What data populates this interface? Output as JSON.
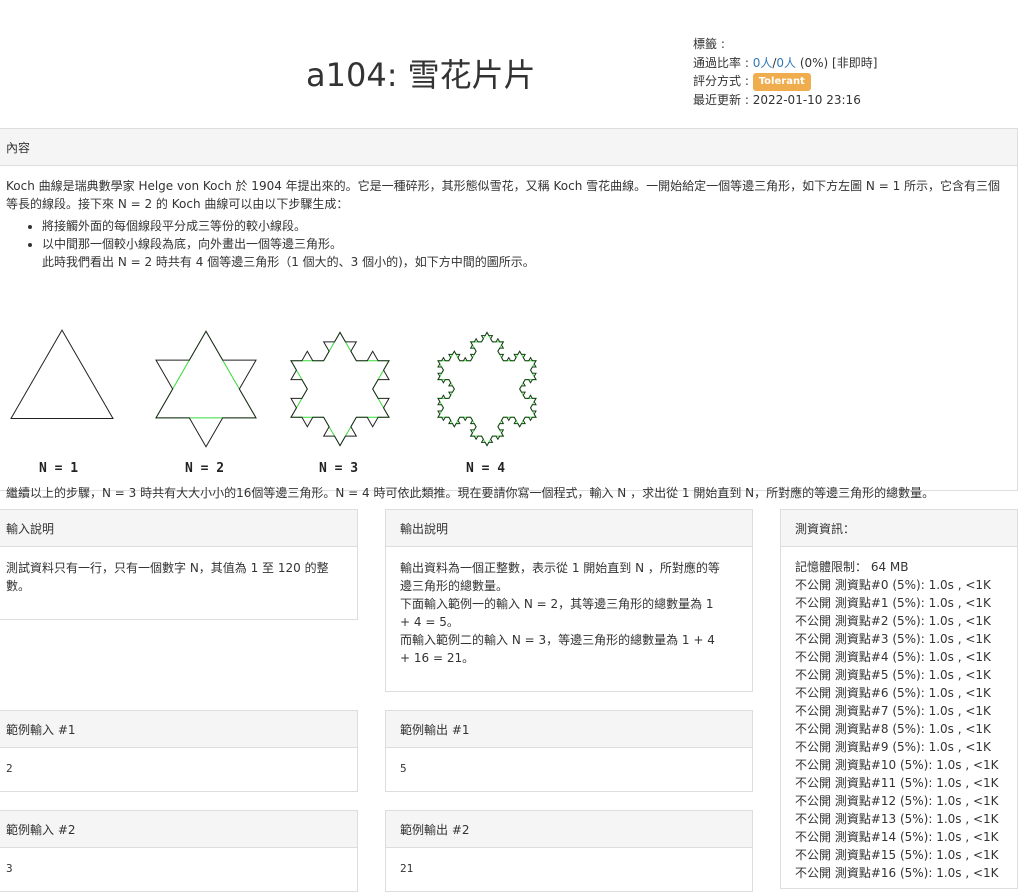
{
  "problem": {
    "title": "a104: 雪花片片"
  },
  "meta": {
    "tags_label": "標籤 :",
    "pass_rate_label": "通過比率 : ",
    "pass_rate_a": "0人",
    "pass_rate_sep": "/",
    "pass_rate_b": "0人",
    "pass_rate_rest": " (0%) [非即時]",
    "judge_label": "評分方式 :",
    "judge_badge": "Tolerant",
    "updated_label": "最近更新 : ",
    "updated_value": "2022-01-10 23:16"
  },
  "content": {
    "header": "內容",
    "para1": "Koch 曲線是瑞典數學家 Helge von Koch 於 1904 年提出來的。它是一種碎形，其形態似雪花，又稱 Koch 雪花曲線。一開始給定一個等邊三角形，如下方左圖 N = 1 所示，它含有三個等長的線段。接下來 N = 2 的 Koch 曲線可以由以下步驟生成：",
    "bullet1": "將接觸外面的每個線段平分成三等份的較小線段。",
    "bullet2": "以中間那一個較小線段為底，向外畫出一個等邊三角形。",
    "bullet2_note": "此時我們看出 N = 2 時共有 4 個等邊三角形（1 個大的、3 個小的)，如下方中間的圖所示。",
    "fig_labels": [
      "N = 1",
      "N = 2",
      "N = 3",
      "N = 4"
    ],
    "para2": "繼續以上的步驟，N = 3 時共有大大小小的16個等邊三角形。N = 4 時可依此類推。現在要請你寫一個程式，輸入 N ，求出從 1 開始直到 N，所對應的等邊三角形的總數量。"
  },
  "input_desc": {
    "header": "輸入說明",
    "body": "測試資料只有一行，只有一個數字 N，其值為 1 至 120 的整數。"
  },
  "output_desc": {
    "header": "輸出說明",
    "body1": "輸出資料為一個正整數，表示從 1 開始直到 N ，所對應的等邊三角形的總數量。",
    "body2": "下面輸入範例一的輸入 N = 2，其等邊三角形的總數量為 1 + 4 = 5。",
    "body3": "而輸入範例二的輸入 N = 3，等邊三角形的總數量為 1 + 4 + 16 = 21。"
  },
  "samples": {
    "in1_header": "範例輸入 #1",
    "in1": "2",
    "out1_header": "範例輸出 #1",
    "out1": "5",
    "in2_header": "範例輸入 #2",
    "in2": "3",
    "out2_header": "範例輸出 #2",
    "out2": "21"
  },
  "testinfo": {
    "header": "測資資訊：",
    "memory": "記憶體限制： 64 MB",
    "cases": [
      "不公開 測資點#0 (5%): 1.0s , <1K",
      "不公開 測資點#1 (5%): 1.0s , <1K",
      "不公開 測資點#2 (5%): 1.0s , <1K",
      "不公開 測資點#3 (5%): 1.0s , <1K",
      "不公開 測資點#4 (5%): 1.0s , <1K",
      "不公開 測資點#5 (5%): 1.0s , <1K",
      "不公開 測資點#6 (5%): 1.0s , <1K",
      "不公開 測資點#7 (5%): 1.0s , <1K",
      "不公開 測資點#8 (5%): 1.0s , <1K",
      "不公開 測資點#9 (5%): 1.0s , <1K",
      "不公開 測資點#10 (5%): 1.0s , <1K",
      "不公開 測資點#11 (5%): 1.0s , <1K",
      "不公開 測資點#12 (5%): 1.0s , <1K",
      "不公開 測資點#13 (5%): 1.0s , <1K",
      "不公開 測資點#14 (5%): 1.0s , <1K",
      "不公開 測資點#15 (5%): 1.0s , <1K",
      "不公開 測資點#16 (5%): 1.0s , <1K"
    ]
  },
  "colors": {
    "link": "#337ab7",
    "badge": "#f0ad4e",
    "panel_header_bg": "#f5f5f5",
    "border": "#dddddd",
    "koch_green": "#33dd33",
    "koch_dark": "#1a3a1a"
  }
}
